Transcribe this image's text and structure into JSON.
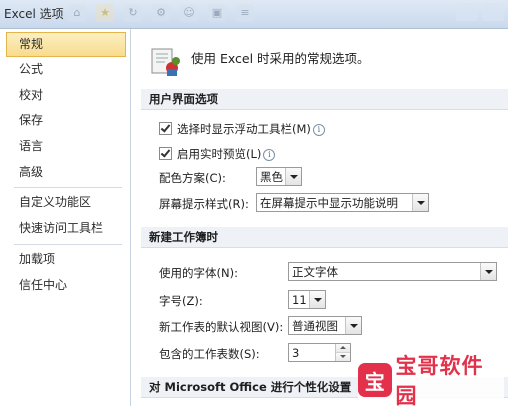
{
  "window": {
    "title": "Excel 选项"
  },
  "sidebar": {
    "items": [
      {
        "label": "常规",
        "selected": true
      },
      {
        "label": "公式"
      },
      {
        "label": "校对"
      },
      {
        "label": "保存"
      },
      {
        "label": "语言"
      },
      {
        "label": "高级"
      },
      {
        "label": "自定义功能区"
      },
      {
        "label": "快速访问工具栏"
      },
      {
        "label": "加载项"
      },
      {
        "label": "信任中心"
      }
    ]
  },
  "header": {
    "text": "使用 Excel 时采用的常规选项。"
  },
  "ui_section": {
    "title": "用户界面选项",
    "mini_toolbar": {
      "label": "选择时显示浮动工具栏(M)",
      "checked": true
    },
    "live_preview": {
      "label": "启用实时预览(L)",
      "checked": true
    },
    "color_scheme": {
      "label": "配色方案(C):",
      "value": "黑色"
    },
    "screentip": {
      "label": "屏幕提示样式(R):",
      "value": "在屏幕提示中显示功能说明"
    }
  },
  "workbook_section": {
    "title": "新建工作簿时",
    "font": {
      "label": "使用的字体(N):",
      "value": "正文字体"
    },
    "font_size": {
      "label": "字号(Z):",
      "value": "11"
    },
    "default_view": {
      "label": "新工作表的默认视图(V):",
      "value": "普通视图"
    },
    "sheet_count": {
      "label": "包含的工作表数(S):",
      "value": "3"
    }
  },
  "office_section": {
    "title": "对 Microsoft Office 进行个性化设置"
  },
  "watermark": {
    "logo_char": "宝",
    "text": "宝哥软件园"
  },
  "colors": {
    "selected_bg": "#f8dc8d",
    "watermark": "#e4314b"
  }
}
